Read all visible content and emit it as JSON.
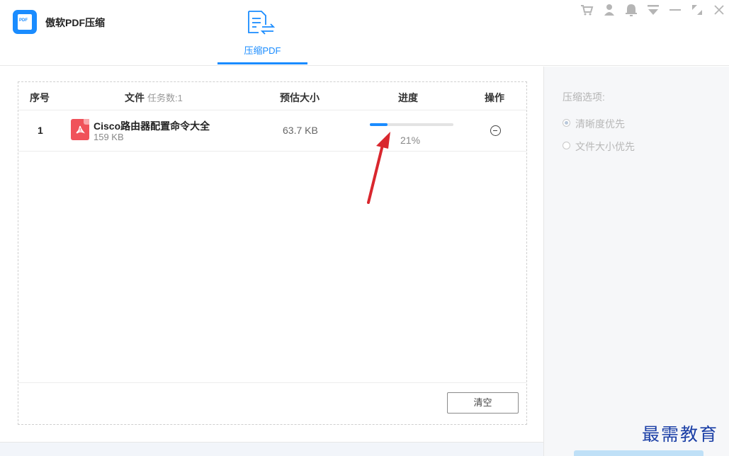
{
  "app": {
    "title": "傲软PDF压缩",
    "logo_text": "PDF",
    "accent_color": "#1a8cff"
  },
  "tabs": [
    {
      "label": "压缩PDF",
      "icon": "compress-document-icon",
      "active": true
    }
  ],
  "window_controls": [
    "cart-icon",
    "user-icon",
    "bell-icon",
    "menu-dropdown-icon",
    "minimize-icon",
    "restore-icon",
    "close-icon"
  ],
  "table": {
    "headers": {
      "index": "序号",
      "file": "文件",
      "task_count": "任务数:1",
      "estimated_size": "预估大小",
      "progress": "进度",
      "action": "操作"
    },
    "rows": [
      {
        "index": "1",
        "file_name": "Cisco路由器配置命令大全",
        "file_size": "159 KB",
        "estimated_size": "63.7 KB",
        "progress": 0.21,
        "progress_text": "21%",
        "file_icon": "pdf-file-icon",
        "action_icon": "remove-circle-icon"
      }
    ],
    "clear_label": "清空"
  },
  "options": {
    "title": "压缩选项:",
    "choices": [
      {
        "label": "清晰度优先",
        "checked": true
      },
      {
        "label": "文件大小优先",
        "checked": false
      }
    ]
  },
  "watermark": "最需教育",
  "colors": {
    "pdf_icon": "#f0525a",
    "annotation_arrow": "#d9272e",
    "progress_track": "#e3e3e3",
    "side_panel_bg": "#f6f7f9"
  }
}
